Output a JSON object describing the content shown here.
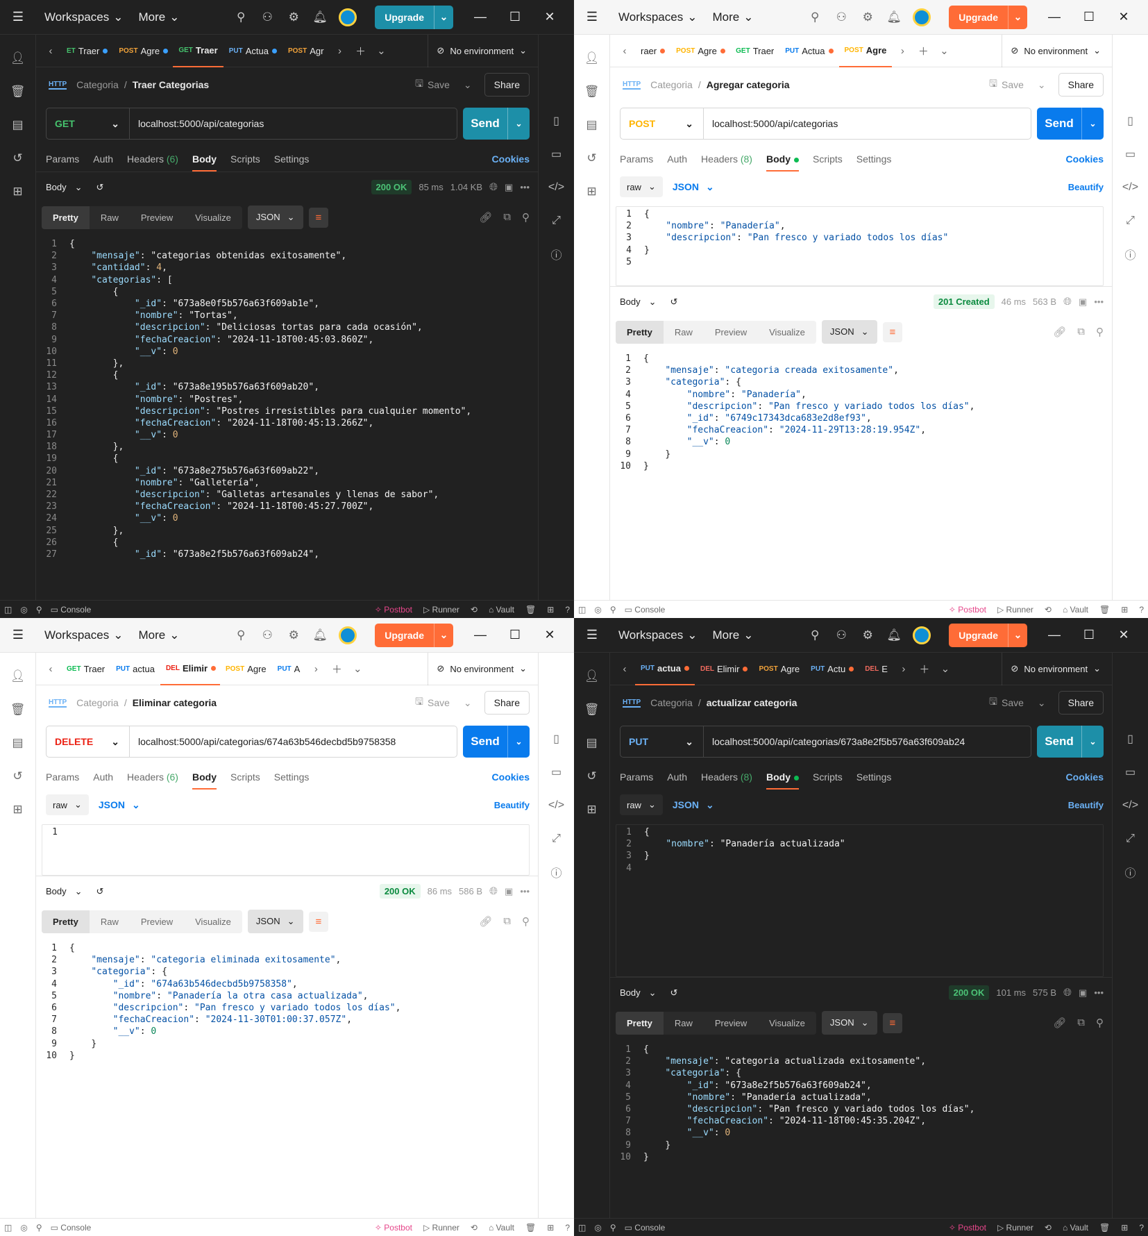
{
  "chrome": {
    "workspaces": "Workspaces",
    "more": "More",
    "upgrade": "Upgrade",
    "no_env": "No environment",
    "save": "Save",
    "share": "Share",
    "send": "Send",
    "cookies": "Cookies",
    "beautify": "Beautify",
    "console": "Console",
    "postbot": "Postbot",
    "runner": "Runner",
    "vault": "Vault",
    "params": "Params",
    "auth": "Auth",
    "body_tab": "Body",
    "scripts": "Scripts",
    "settings": "Settings",
    "body_label": "Body",
    "raw": "raw",
    "json": "JSON",
    "pretty": "Pretty",
    "raw_view": "Raw",
    "preview": "Preview",
    "visualize": "Visualize",
    "http": "HTTP"
  },
  "windows": [
    {
      "theme": "dark",
      "tabs": [
        {
          "method": "ET",
          "name": "Traer",
          "dot": "b",
          "cls": "get"
        },
        {
          "method": "POST",
          "name": "Agre",
          "dot": "b",
          "cls": "post"
        },
        {
          "method": "GET",
          "name": "Traer",
          "dot": "",
          "cls": "get",
          "active": true
        },
        {
          "method": "PUT",
          "name": "Actua",
          "dot": "b",
          "cls": "put"
        },
        {
          "method": "POST",
          "name": "Agr",
          "dot": "",
          "cls": "post"
        }
      ],
      "collection": "Categoria",
      "request_name": "Traer Categorias",
      "method": "GET",
      "url": "localhost:5000/api/categorias",
      "headers": "Headers",
      "headers_count": "(6)",
      "request_body": null,
      "status": "200 OK",
      "time": "85 ms",
      "size": "1.04 KB",
      "response": [
        "{",
        "    \"mensaje\": \"categorias obtenidas exitosamente\",",
        "    \"cantidad\": 4,",
        "    \"categorias\": [",
        "        {",
        "            \"_id\": \"673a8e0f5b576a63f609ab1e\",",
        "            \"nombre\": \"Tortas\",",
        "            \"descripcion\": \"Deliciosas tortas para cada ocasión\",",
        "            \"fechaCreacion\": \"2024-11-18T00:45:03.860Z\",",
        "            \"__v\": 0",
        "        },",
        "        {",
        "            \"_id\": \"673a8e195b576a63f609ab20\",",
        "            \"nombre\": \"Postres\",",
        "            \"descripcion\": \"Postres irresistibles para cualquier momento\",",
        "            \"fechaCreacion\": \"2024-11-18T00:45:13.266Z\",",
        "            \"__v\": 0",
        "        },",
        "        {",
        "            \"_id\": \"673a8e275b576a63f609ab22\",",
        "            \"nombre\": \"Galletería\",",
        "            \"descripcion\": \"Galletas artesanales y llenas de sabor\",",
        "            \"fechaCreacion\": \"2024-11-18T00:45:27.700Z\",",
        "            \"__v\": 0",
        "        },",
        "        {",
        "            \"_id\": \"673a8e2f5b576a63f609ab24\","
      ]
    },
    {
      "theme": "light",
      "tabs": [
        {
          "method": "",
          "name": "raer",
          "dot": "o",
          "cls": "get"
        },
        {
          "method": "POST",
          "name": "Agre",
          "dot": "o",
          "cls": "post"
        },
        {
          "method": "GET",
          "name": "Traer",
          "dot": "",
          "cls": "get"
        },
        {
          "method": "PUT",
          "name": "Actua",
          "dot": "o",
          "cls": "put"
        },
        {
          "method": "POST",
          "name": "Agre",
          "dot": "",
          "cls": "post",
          "active": true
        }
      ],
      "collection": "Categoria",
      "request_name": "Agregar categoria",
      "method": "POST",
      "url": "localhost:5000/api/categorias",
      "headers": "Headers",
      "headers_count": "(8)",
      "request_body": [
        "{",
        "    \"nombre\": \"Panadería\",",
        "    \"descripcion\": \"Pan fresco y variado todos los días\"",
        "}",
        ""
      ],
      "status": "201 Created",
      "time": "46 ms",
      "size": "563 B",
      "response": [
        "{",
        "    \"mensaje\": \"categoria creada exitosamente\",",
        "    \"categoria\": {",
        "        \"nombre\": \"Panadería\",",
        "        \"descripcion\": \"Pan fresco y variado todos los días\",",
        "        \"_id\": \"6749c17343dca683e2d8ef93\",",
        "        \"fechaCreacion\": \"2024-11-29T13:28:19.954Z\",",
        "        \"__v\": 0",
        "    }",
        "}"
      ]
    },
    {
      "theme": "light",
      "tabs": [
        {
          "method": "GET",
          "name": "Traer",
          "dot": "",
          "cls": "get"
        },
        {
          "method": "PUT",
          "name": "actua",
          "dot": "",
          "cls": "put"
        },
        {
          "method": "DEL",
          "name": "Elimir",
          "dot": "o",
          "cls": "del",
          "active": true
        },
        {
          "method": "POST",
          "name": "Agre",
          "dot": "",
          "cls": "post"
        },
        {
          "method": "PUT",
          "name": "A",
          "dot": "",
          "cls": "put"
        }
      ],
      "collection": "Categoria",
      "request_name": "Eliminar categoria",
      "method": "DELETE",
      "url": "localhost:5000/api/categorias/674a63b546decbd5b9758358",
      "headers": "Headers",
      "headers_count": "(6)",
      "request_body": [
        ""
      ],
      "status": "200 OK",
      "time": "86 ms",
      "size": "586 B",
      "response": [
        "{",
        "    \"mensaje\": \"categoria eliminada exitosamente\",",
        "    \"categoria\": {",
        "        \"_id\": \"674a63b546decbd5b9758358\",",
        "        \"nombre\": \"Panadería la otra casa actualizada\",",
        "        \"descripcion\": \"Pan fresco y variado todos los días\",",
        "        \"fechaCreacion\": \"2024-11-30T01:00:37.057Z\",",
        "        \"__v\": 0",
        "    }",
        "}"
      ]
    },
    {
      "theme": "dark",
      "tabs": [
        {
          "method": "PUT",
          "name": "actua",
          "dot": "o",
          "cls": "put",
          "active": true
        },
        {
          "method": "DEL",
          "name": "Elimir",
          "dot": "o",
          "cls": "del"
        },
        {
          "method": "POST",
          "name": "Agre",
          "dot": "",
          "cls": "post"
        },
        {
          "method": "PUT",
          "name": "Actu",
          "dot": "o",
          "cls": "put"
        },
        {
          "method": "DEL",
          "name": "E",
          "dot": "",
          "cls": "del"
        }
      ],
      "collection": "Categoria",
      "request_name": "actualizar categoria",
      "method": "PUT",
      "url": "localhost:5000/api/categorias/673a8e2f5b576a63f609ab24",
      "headers": "Headers",
      "headers_count": "(8)",
      "request_body": [
        "{",
        "    \"nombre\": \"Panadería actualizada\"",
        "}",
        ""
      ],
      "status": "200 OK",
      "time": "101 ms",
      "size": "575 B",
      "response": [
        "{",
        "    \"mensaje\": \"categoria actualizada exitosamente\",",
        "    \"categoria\": {",
        "        \"_id\": \"673a8e2f5b576a63f609ab24\",",
        "        \"nombre\": \"Panadería actualizada\",",
        "        \"descripcion\": \"Pan fresco y variado todos los días\",",
        "        \"fechaCreacion\": \"2024-11-18T00:45:35.204Z\",",
        "        \"__v\": 0",
        "    }",
        "}"
      ]
    }
  ]
}
